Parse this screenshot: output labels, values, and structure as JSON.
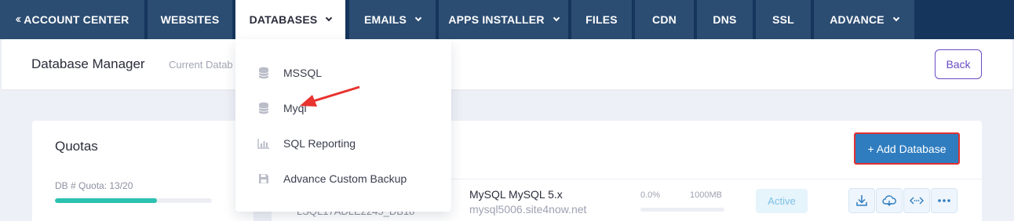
{
  "nav": {
    "tabs": [
      {
        "label": "ACCOUNT CENTER"
      },
      {
        "label": "WEBSITES"
      },
      {
        "label": "DATABASES"
      },
      {
        "label": "EMAILS"
      },
      {
        "label": "APPS INSTALLER"
      },
      {
        "label": "FILES"
      },
      {
        "label": "CDN"
      },
      {
        "label": "DNS"
      },
      {
        "label": "SSL"
      },
      {
        "label": "ADVANCE"
      }
    ],
    "active": "DATABASES"
  },
  "dropdown": {
    "items": [
      {
        "label": "MSSQL",
        "icon": "database-icon"
      },
      {
        "label": "Myql",
        "icon": "database-icon"
      },
      {
        "label": "SQL Reporting",
        "icon": "bar-chart-icon"
      },
      {
        "label": "Advance Custom Backup",
        "icon": "save-icon"
      }
    ]
  },
  "header": {
    "title": "Database Manager",
    "subtitle": "Current Datab",
    "back_label": "Back"
  },
  "quotas": {
    "title": "Quotas",
    "db_quota_label": "DB # Quota: 13/20",
    "db_quota_fraction": 0.65
  },
  "main": {
    "add_button": "+ Add Database",
    "rows": [
      {
        "name_partial": "LSQL17ADLE2245_DB18",
        "type": "MySQL MySQL 5.x",
        "host": "mysql5006.site4now.net",
        "usage": "0.0%",
        "limit": "1000MB",
        "usage_fraction": 0.0,
        "status": "Active"
      }
    ]
  },
  "colors": {
    "nav_bg": "#15355c",
    "tab_bg": "#2c4d72",
    "accent": "#2f7dbf",
    "highlight": "#e0302f",
    "progress": "#2cc1b1"
  }
}
